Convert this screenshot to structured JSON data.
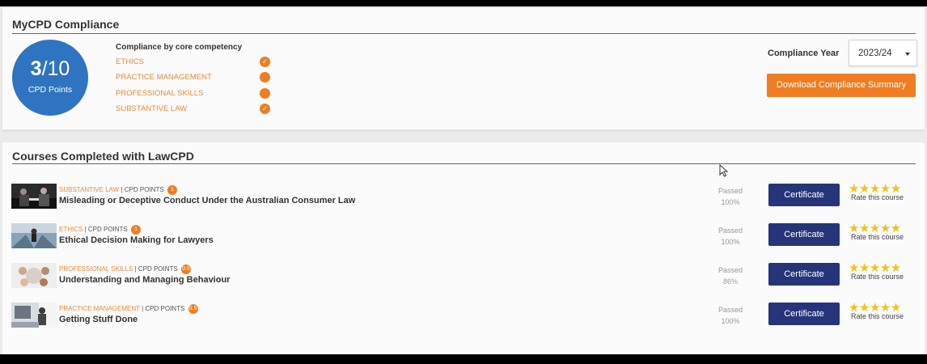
{
  "compliance": {
    "title": "MyCPD Compliance",
    "points_earned": "3",
    "points_total": "10",
    "points_label": "CPD Points",
    "competency_heading": "Compliance by core competency",
    "competencies": [
      {
        "label": "ETHICS",
        "status": "complete",
        "icon": "check-icon"
      },
      {
        "label": "PRACTICE MANAGEMENT",
        "status": "incomplete",
        "icon": "dot-icon"
      },
      {
        "label": "PROFESSIONAL SKILLS",
        "status": "incomplete",
        "icon": "dot-icon"
      },
      {
        "label": "SUBSTANTIVE LAW",
        "status": "complete",
        "icon": "check-icon"
      }
    ],
    "year_label": "Compliance Year",
    "year_value": "2023/24",
    "download_label": "Download Compliance Summary"
  },
  "courses": {
    "title": "Courses Completed with LawCPD",
    "points_text": "CPD POINTS",
    "passed_text": "Passed",
    "certificate_label": "Certificate",
    "rate_label": "Rate this course",
    "stars": "★★★★★",
    "items": [
      {
        "category": "SUBSTANTIVE LAW",
        "points": "1",
        "title": "Misleading or Deceptive Conduct Under the Australian Consumer Law",
        "score": "100%"
      },
      {
        "category": "ETHICS",
        "points": "1",
        "title": "Ethical Decision Making for Lawyers",
        "score": "100%"
      },
      {
        "category": "PROFESSIONAL SKILLS",
        "points": "0.5",
        "title": "Understanding and Managing Behaviour",
        "score": "86%"
      },
      {
        "category": "PRACTICE MANAGEMENT",
        "points": "0.5",
        "title": "Getting Stuff Done",
        "score": "100%"
      }
    ]
  },
  "colors": {
    "accent_orange": "#ef7d22",
    "circle_blue": "#2f74c0",
    "button_navy": "#26357a",
    "star_yellow": "#f0c419"
  }
}
